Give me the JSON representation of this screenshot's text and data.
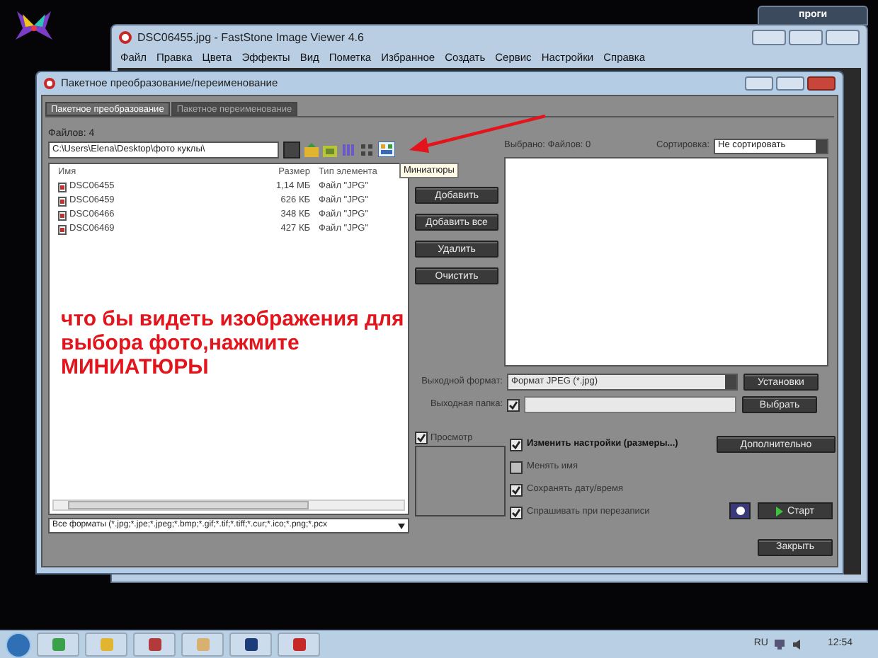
{
  "desktop": {
    "shortcut_label": "проги"
  },
  "background_window": {
    "title": "DSC06455.jpg - FastStone Image Viewer 4.6",
    "menu": [
      "Файл",
      "Правка",
      "Цвета",
      "Эффекты",
      "Вид",
      "Пометка",
      "Избранное",
      "Создать",
      "Сервис",
      "Настройки",
      "Справка"
    ]
  },
  "dialog": {
    "title": "Пакетное преобразование/переименование",
    "tabs": [
      {
        "label": "Пакетное преобразование",
        "selected": true
      },
      {
        "label": "Пакетное переименование",
        "selected": false
      }
    ],
    "files_count": "Файлов: 4",
    "path": "C:\\Users\\Elena\\Desktop\\фото куклы\\",
    "tooltip": "Миниатюры",
    "file_list": {
      "columns": [
        "Имя",
        "Размер",
        "Тип элемента"
      ],
      "rows": [
        {
          "name": "DSC06455",
          "size": "1,14 МБ",
          "type": "Файл \"JPG\""
        },
        {
          "name": "DSC06459",
          "size": "626 КБ",
          "type": "Файл \"JPG\""
        },
        {
          "name": "DSC06466",
          "size": "348 КБ",
          "type": "Файл \"JPG\""
        },
        {
          "name": "DSC06469",
          "size": "427 КБ",
          "type": "Файл \"JPG\""
        }
      ]
    },
    "annotation": "что бы видеть изображения для выбора фото,нажмите МИНИАТЮРЫ",
    "filter": "Все форматы (*.jpg;*.jpe;*.jpeg;*.bmp;*.gif;*.tif;*.tiff;*.cur;*.ico;*.png;*.pcx",
    "list_buttons": [
      "Добавить",
      "Добавить все",
      "Удалить",
      "Очистить"
    ],
    "selected_count": "Выбрано: Файлов: 0",
    "sort_label": "Сортировка:",
    "sort_value": "Не сортировать",
    "output_format_label": "Выходной формат:",
    "output_format_value": "Формат JPEG (*.jpg)",
    "settings_button": "Установки",
    "output_folder_label": "Выходная папка:",
    "output_folder_checked": true,
    "choose_button": "Выбрать",
    "preview": {
      "label": "Просмотр",
      "checked": true
    },
    "options": [
      {
        "label": "Изменить настройки (размеры...)",
        "checked": true
      },
      {
        "label": "Менять имя",
        "checked": false
      },
      {
        "label": "Сохранять дату/время",
        "checked": true
      },
      {
        "label": "Спрашивать при перезаписи",
        "checked": true
      }
    ],
    "advanced_button": "Дополнительно",
    "start_button": "Старт",
    "close_button": "Закрыть"
  },
  "taskbar": {
    "language": "RU",
    "clock": "12:54"
  }
}
